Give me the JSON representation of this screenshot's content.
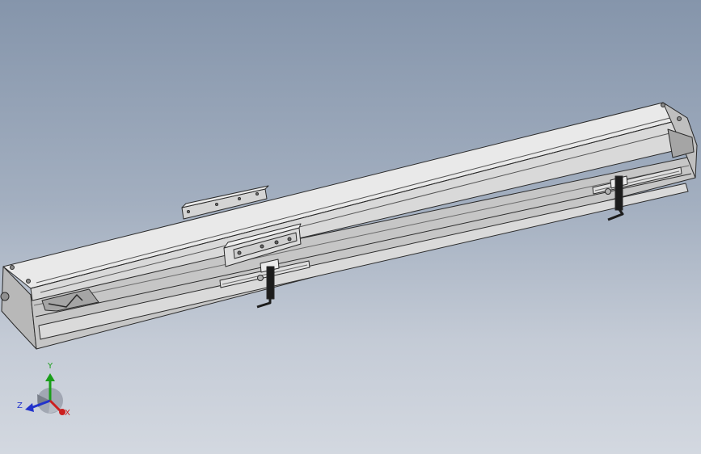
{
  "triad": {
    "y_label": "Y",
    "z_label": "Z",
    "x_label": "X",
    "y_color": "#1a9e1a",
    "z_color": "#2233cc",
    "x_color": "#cc1f1f"
  },
  "colors": {
    "background_top": "#8595ab",
    "background_bottom": "#d3d8e0",
    "part_face_light": "#e2e2e2",
    "part_face_mid": "#c8c8c8",
    "part_face_dark": "#a9a9a9",
    "edge": "#2b2b2b",
    "sensor_dark": "#1c1c1c"
  }
}
